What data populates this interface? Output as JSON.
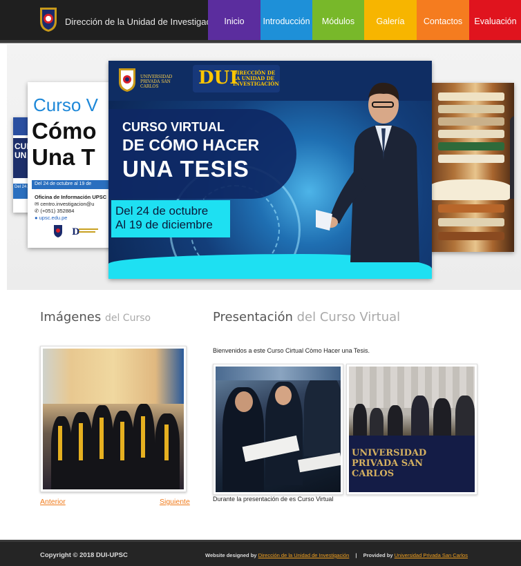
{
  "header": {
    "site_title": "Dirección de la Unidad de Investigación",
    "nav": [
      {
        "label": "Inicio",
        "color": "#5b2d9e"
      },
      {
        "label": "Introducción",
        "color": "#1e90d8"
      },
      {
        "label": "Módulos",
        "color": "#78b82a"
      },
      {
        "label": "Galería",
        "color": "#f7b500"
      },
      {
        "label": "Contactos",
        "color": "#f57c1f"
      },
      {
        "label": "Evaluación",
        "color": "#e0141e"
      }
    ]
  },
  "slider": {
    "main": {
      "university_line": "UNIVERSIDAD PRIVADA SAN CARLOS",
      "dui_mark": "DUI",
      "dui_text": "DIRECCIÓN DE LA UNIDAD DE INVESTIGACIÓN",
      "title_line1": "CURSO VIRTUAL",
      "title_line2": "DE CÓMO HACER",
      "title_line3": "UNA TESIS",
      "date_line1": "Del 24 de octubre",
      "date_line2": "Al 19 de diciembre"
    },
    "left": {
      "curso": "Curso V",
      "como": "Cómo",
      "una": "Una T",
      "date": "Del 24 de octubre al 19 de",
      "info_title": "Oficina de Información UPSC",
      "email": "✉ centro.investigacion@u",
      "phone": "✆ (+051) 352884",
      "web": "● upsc.edu.pe"
    },
    "back": {
      "text": "CUR DE UN",
      "date": "Del 24 Al 19"
    }
  },
  "images_section": {
    "title_strong": "Imágenes",
    "title_light": "del Curso",
    "prev_label": "Anterior",
    "next_label": "Siguiente"
  },
  "presentation_section": {
    "title_strong": "Presentación",
    "title_light": "del Curso Virtual",
    "welcome": "Bienvenidos a este Curso Cirtual Còmo Hacer una Tesis.",
    "banner_text": "UNIVERSIDAD PRIVADA SAN CARLOS",
    "caption": "Durante la presentación de es Curso Virtual"
  },
  "footer": {
    "copyright": "Copyright © 2018 DUI-UPSC",
    "designed_prefix": "Website designed by",
    "designed_link": "Dirección de la Unidad de Investigación",
    "separator": "|",
    "provided_prefix": "Provided by",
    "provided_link": "Universidad Privada San Carlos"
  }
}
